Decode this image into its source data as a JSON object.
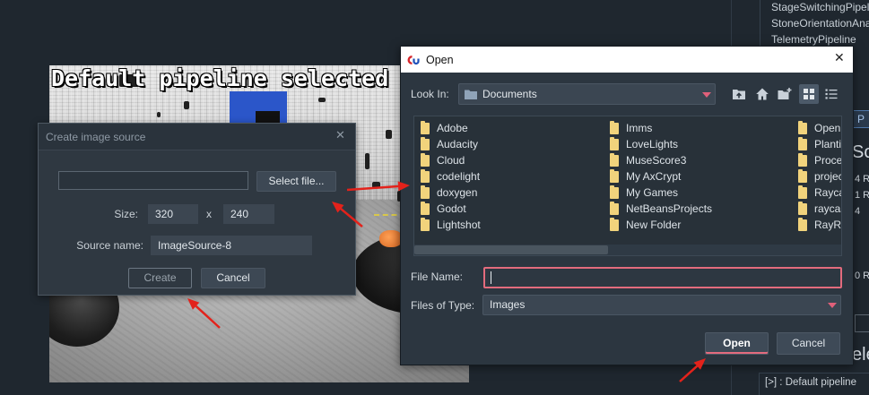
{
  "camera": {
    "overlay_text": "Default pipeline selected"
  },
  "pipeline_panel": {
    "pipelines": [
      "StageSwitchingPipeli",
      "StoneOrientationAna",
      "TelemetryPipeline"
    ],
    "button_label": "P",
    "section_heading": "So",
    "stats": [
      "4 R",
      "1 R",
      "4",
      "0 R"
    ],
    "section_heading_2": "ele",
    "console_line": "[>] : Default pipeline"
  },
  "create_dialog": {
    "title": "Create image source",
    "file_path_value": "",
    "select_file_label": "Select file...",
    "size_label": "Size:",
    "width_value": "320",
    "size_separator": "x",
    "height_value": "240",
    "source_name_label": "Source name:",
    "source_name_value": "ImageSource-8",
    "create_label": "Create",
    "cancel_label": "Cancel"
  },
  "open_dialog": {
    "title": "Open",
    "look_in_label": "Look In:",
    "look_in_value": "Documents",
    "toolbar_icons": [
      "up-one-level-icon",
      "home-icon",
      "new-folder-icon",
      "list-view-icon",
      "details-view-icon"
    ],
    "files": [
      "Adobe",
      "Audacity",
      "Cloud",
      "codelight",
      "doxygen",
      "Godot",
      "Lightshot",
      "Imms",
      "LoveLights",
      "MuseScore3",
      "My AxCrypt",
      "My Games",
      "NetBeansProjects",
      "New Folder",
      "Open",
      "Planti",
      "Proce",
      "projec",
      "Rayca",
      "raycas",
      "RayR"
    ],
    "file_name_label": "File Name:",
    "file_name_value": "",
    "files_of_type_label": "Files of Type:",
    "files_of_type_value": "Images",
    "open_label": "Open",
    "cancel_label": "Cancel"
  },
  "colors": {
    "page_background": "#1f272f",
    "dialog_background": "#2c3640",
    "title_bar_background": "#ffffff",
    "focus_border": "#e36b7d",
    "dropdown_arrow": "#e0607a",
    "folder_icon": "#f1d37c",
    "annotation_arrow": "#e3221b"
  }
}
